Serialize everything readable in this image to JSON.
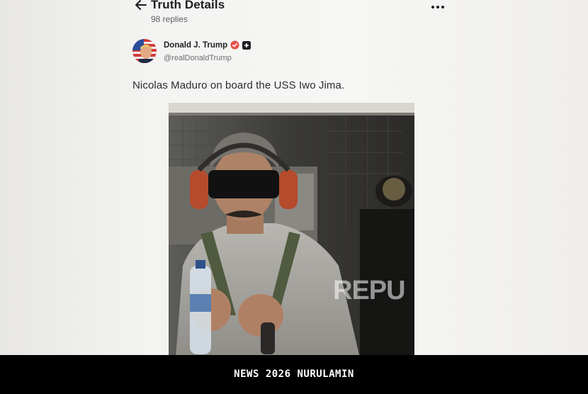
{
  "header": {
    "title": "Truth Details",
    "replies": "98 replies",
    "back_icon": "arrow-left-icon",
    "more_icon": "ellipsis-icon"
  },
  "post": {
    "author_name": "Donald J. Trump",
    "author_handle": "@realDonaldTrump",
    "verified_color": "#e8504a",
    "text": "Nicolas Maduro on board the USS Iwo Jima.",
    "image_watermark": "REPU"
  },
  "footer": {
    "caption": "NEWS 2026 NURULAMIN"
  }
}
